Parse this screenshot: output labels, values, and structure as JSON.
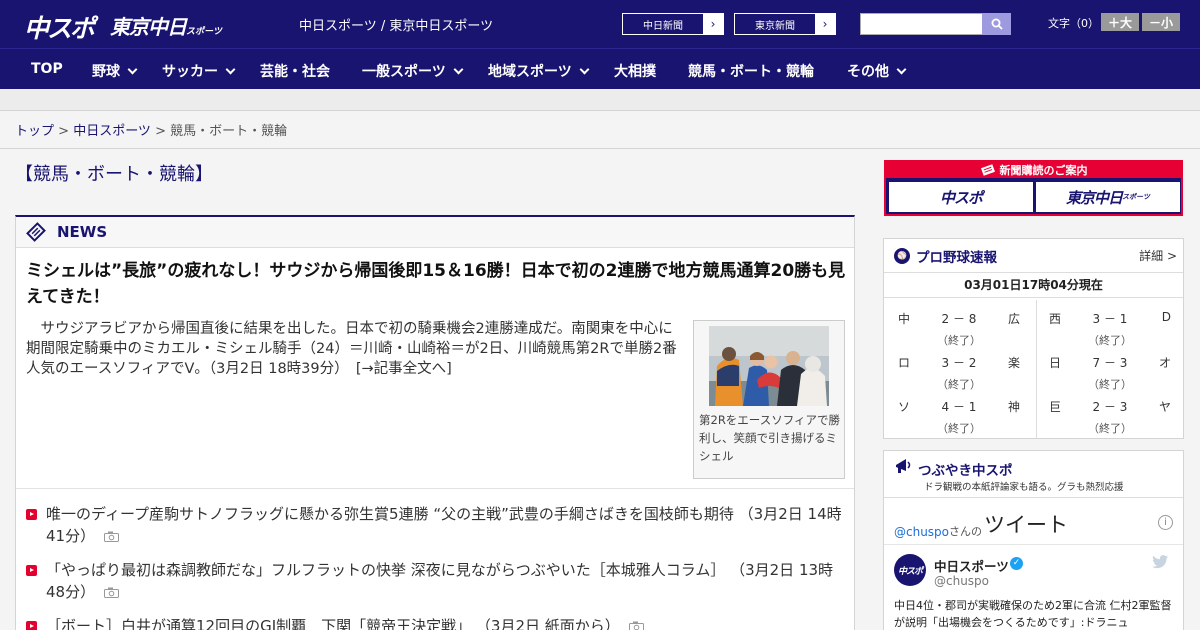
{
  "header": {
    "logo_chuspo": "中スポ",
    "logo_tokyo": "東京中日",
    "logo_tokyo_small": "スポーツ",
    "site_names": "中日スポーツ / 東京中日スポーツ",
    "site_link_1": "中日新聞",
    "site_link_2": "東京新聞",
    "search_placeholder": "",
    "font_size_label": "文字（0）",
    "font_larger": "＋大",
    "font_smaller": "－小"
  },
  "nav": {
    "items": [
      {
        "label": "TOP"
      },
      {
        "label": "野球"
      },
      {
        "label": "サッカー"
      },
      {
        "label": "芸能・社会"
      },
      {
        "label": "一般スポーツ"
      },
      {
        "label": "地域スポーツ"
      },
      {
        "label": "大相撲"
      },
      {
        "label": "競馬・ボート・競輪"
      },
      {
        "label": "その他"
      }
    ]
  },
  "breadcrumb": {
    "home": "トップ",
    "sep": " > ",
    "parent": "中日スポーツ",
    "current": "競馬・ボート・競輪"
  },
  "page": {
    "title": "【競馬・ボート・競輪】"
  },
  "news": {
    "section_label": "NEWS",
    "headline": "ミシェルは”長旅”の疲れなし！サウジから帰国後即15＆16勝！日本で初の2連勝で地方競馬通算20勝も見えてきた！",
    "lead": "サウジアラビアから帰国直後に結果を出した。日本で初の騎乗機会2連勝達成だ。南関東を中心に期間限定騎乗中のミカエル・ミシェル騎手（24）＝川崎・山崎裕＝が2日、川崎競馬第2Rで単勝2番人気のエースソフィアでV。（3月2日 18時39分）　[→記事全文へ]",
    "photo_caption": "第2Rをエースソフィアで勝利し、笑顔で引き揚げるミシェル",
    "items": [
      {
        "text": "唯一のディープ産駒サトノフラッグに懸かる弥生賞5連勝 “父の主戦”武豊の手綱さばきを国枝師も期待 （3月2日 14時41分）"
      },
      {
        "text": "「やっぱり最初は森調教師だな」フルフラットの快挙 深夜に見ながらつぶやいた［本城雅人コラム］ （3月2日 13時48分）"
      },
      {
        "text": "［ボート］白井が通算12回目のGI制覇　下関「競帝王決定戦」 （3月2日 紙面から）"
      }
    ]
  },
  "sidebar": {
    "ad": {
      "label": "新聞購読のご案内",
      "logo_chuspo": "中スポ",
      "logo_tokyo": "東京中日",
      "logo_tokyo_small": "スポーツ"
    },
    "scores": {
      "title": "プロ野球速報",
      "detail": "詳細 >",
      "updated": "03月01日17時04分現在",
      "games": [
        {
          "team1": "中",
          "score": "2 － 8",
          "team2": "広",
          "status": "（終了）"
        },
        {
          "team1": "西",
          "score": "3 － 1",
          "team2": "D",
          "status": "（終了）"
        },
        {
          "team1": "ロ",
          "score": "3 － 2",
          "team2": "楽",
          "status": "（終了）"
        },
        {
          "team1": "日",
          "score": "7 － 3",
          "team2": "オ",
          "status": "（終了）"
        },
        {
          "team1": "ソ",
          "score": "4 － 1",
          "team2": "神",
          "status": "（終了）"
        },
        {
          "team1": "巨",
          "score": "2 － 3",
          "team2": "ヤ",
          "status": "（終了）"
        }
      ]
    },
    "twitter": {
      "title": "つぶやき中スポ",
      "subtitle": "ドラ観戦の本紙評論家も語る。グラも熱烈応援",
      "handle": "@chuspo",
      "san": "さんの",
      "tweet_label": "ツイート",
      "info": "i",
      "avatar_text": "中スポ",
      "account_name": "中日スポーツ",
      "account_id": "@chuspo",
      "verified": "✓",
      "tweet_text": "中日4位・郡司が実戦確保のため2軍に合流 仁村2軍監督が説明「出場機会をつくるためです」:ドラニュ"
    }
  },
  "colors": {
    "brand_navy": "#191470",
    "accent_red": "#e60033",
    "link_blue": "#1b6ed8"
  }
}
